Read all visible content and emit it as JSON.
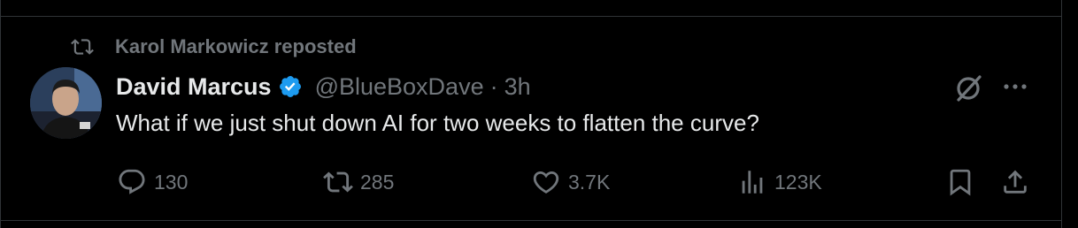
{
  "repost": {
    "text": "Karol Markowicz reposted",
    "icon": "repost-icon"
  },
  "author": {
    "name": "David Marcus",
    "handle": "@BlueBoxDave",
    "separator": "·",
    "time": "3h",
    "verified": true,
    "verified_color": "#1d9bf0"
  },
  "tweet": {
    "text": "What if we just shut down AI for two weeks to flatten the curve?"
  },
  "actions": {
    "replies": "130",
    "reposts": "285",
    "likes": "3.7K",
    "views": "123K"
  },
  "colors": {
    "background": "#000000",
    "text": "#e7e9ea",
    "muted": "#71767b",
    "border": "#2f3336"
  }
}
